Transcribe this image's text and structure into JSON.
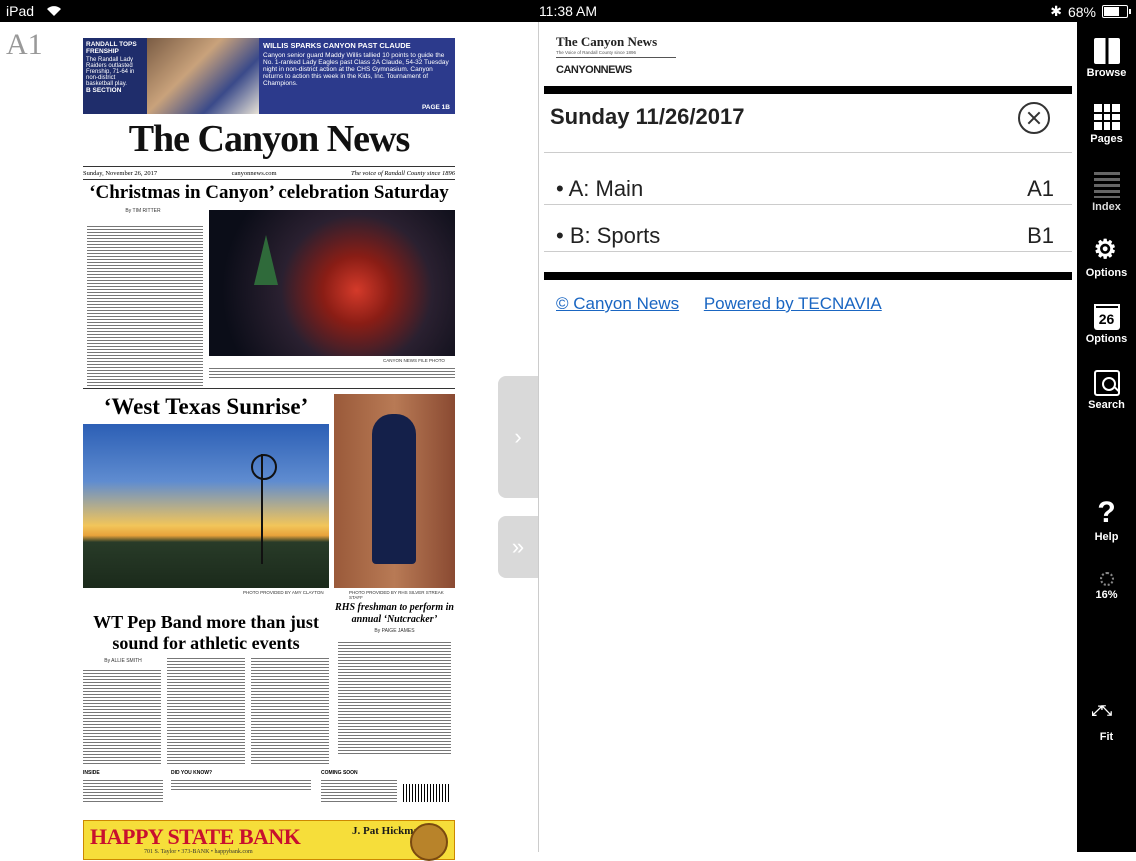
{
  "status": {
    "device": "iPad",
    "time": "11:38 AM",
    "battery": "68%",
    "battery_level": 0.68
  },
  "page_label": "A1",
  "newspaper": {
    "promo_left_title": "RANDALL TOPS FRENSHIP",
    "promo_left_text": "The Randall Lady Raiders outlasted Frenship, 71-64 in non-district basketball play.",
    "promo_left_section": "B SECTION",
    "promo_right_title": "WILLIS SPARKS CANYON PAST CLAUDE",
    "promo_right_text": "Canyon senior guard Maddy Willis tallied 10 points to guide the No. 1-ranked Lady Eagles past Class 2A Claude, 54-32 Tuesday night in non-district action at the CHS Gymnasium. Canyon returns to action this week in the Kids, Inc. Tournament of Champions.",
    "promo_right_page": "PAGE 1B",
    "masthead": "The Canyon News",
    "date": "Sunday, November 26, 2017",
    "site": "canyonnews.com",
    "motto": "The voice of Randall County since 1896",
    "headline1": "‘Christmas in Canyon’ celebration Saturday",
    "byline1": "By TIM RITTER",
    "photo1_credit": "CANYON NEWS FILE PHOTO",
    "headline2": "‘West Texas Sunrise’",
    "photo2_credit": "PHOTO PROVIDED BY AMY CLAYTON",
    "photo3_credit": "PHOTO PROVIDED BY RHS SILVER STREAK STAFF",
    "headline3": "WT Pep Band more than just sound for athletic events",
    "byline3": "By ALLIE SMITH",
    "headline4": "RHS freshman to perform in annual ‘Nutcracker’",
    "byline4": "By PAIGE JAMES",
    "inside_label": "INSIDE",
    "did_you_know": "DID YOU KNOW?",
    "coming_soon": "COMING SOON",
    "ad_main": "HAPPY STATE BANK",
    "ad_sub": "701 S. Taylor • 373-BANK • happybank.com",
    "ad_name": "J. Pat Hickman"
  },
  "index": {
    "logo_title": "The Canyon News",
    "logo_motto": "The Voice of Randall County since 1896",
    "logo_brand": "CANYONNEWS",
    "date": "Sunday 11/26/2017",
    "sections": [
      {
        "name": "• A: Main",
        "code": "A1"
      },
      {
        "name": "• B: Sports",
        "code": "B1"
      }
    ],
    "copyright_link": "© Canyon News",
    "powered_link": "Powered by TECNAVIA"
  },
  "toolbar": {
    "browse": "Browse",
    "pages": "Pages",
    "index": "Index",
    "options1": "Options",
    "calendar_day": "26",
    "options2": "Options",
    "search": "Search",
    "help": "Help",
    "progress": "16%",
    "fit": "Fit"
  },
  "tabs": {
    "next": "›",
    "last": "»"
  }
}
